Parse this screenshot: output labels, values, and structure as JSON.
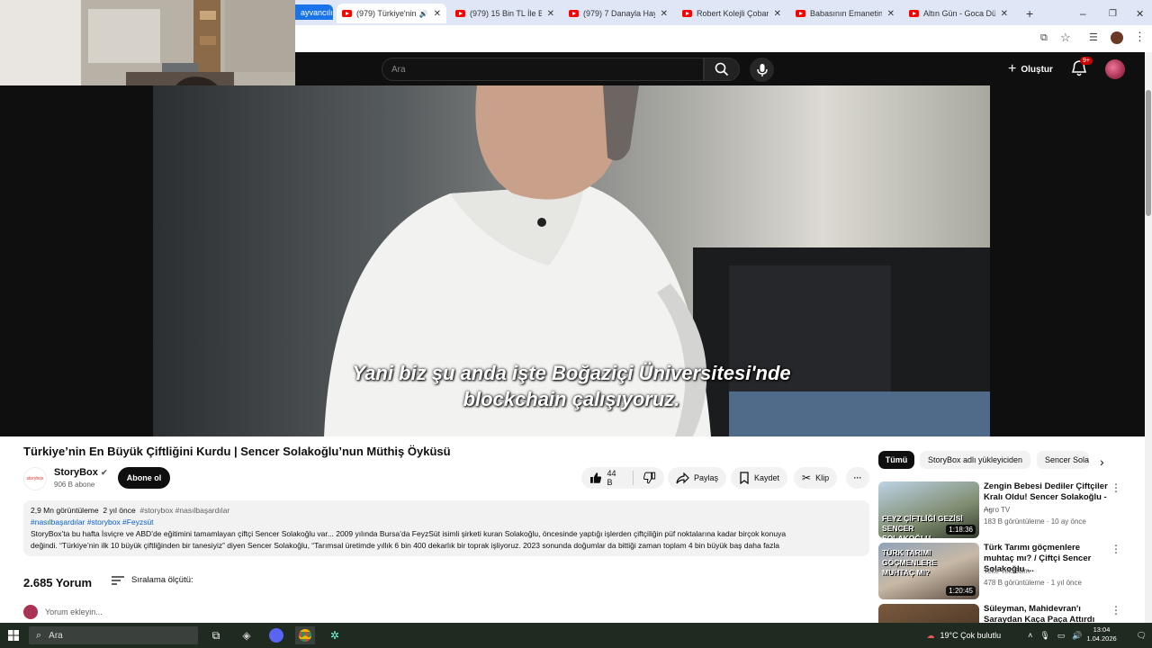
{
  "browser": {
    "tabs": [
      {
        "label": "(979) Türkiye'nin En Bü",
        "active": true
      },
      {
        "label": "(979) 15 Bin TL İle Başl"
      },
      {
        "label": "(979) 7 Danayla Hayval"
      },
      {
        "label": "Robert Kolejli Çoban |"
      },
      {
        "label": "Babasının Emanetine S"
      },
      {
        "label": "Altın Gün - Goca Dünya"
      }
    ],
    "partial_tab": "ayvancılık",
    "new_tab_label": "+"
  },
  "youtube_header": {
    "search_placeholder": "Ara",
    "create_label": "Oluştur",
    "notifications_badge": "9+"
  },
  "video": {
    "subtitle_line1": "Yani biz şu anda işte Boğaziçi Üniversitesi'nde",
    "subtitle_line2": "blockchain çalışıyoruz.",
    "title": "Türkiye’nin En Büyük Çiftliğini Kurdu | Sencer Solakoğlu’nun Müthiş Öyküsü"
  },
  "channel": {
    "name": "StoryBox",
    "subscribers": "906 B abone",
    "subscribe_label": "Abone ol",
    "logo_text": "storybox"
  },
  "actions": {
    "likes": "44 B",
    "share": "Paylaş",
    "save": "Kaydet",
    "clip": "Klip",
    "more": "···"
  },
  "description": {
    "views": "2,9 Mn görüntüleme",
    "age": "2 yıl önce",
    "tags_line1": "#storybox #nasılbaşardılar",
    "tags_line2": "#nasılbaşardılar #storybox #Feyzsüt",
    "line1": "StoryBox’ta bu hafta İsviçre ve ABD’de eğitimini tamamlayan çiftçi Sencer Solakoğlu var... 2009 yılında Bursa’da FeyzSüt isimli şirketi kuran Solakoğlu, öncesinde yaptığı işlerden çiftçiliğin püf noktalarına kadar birçok konuya",
    "line2": "değindi. “Türkiye’nin ilk 10 büyük çiftliğinden bir tanesiyiz” diyen Sencer Solakoğlu, “Tarımsal üretimde yıllık 6 bin 400 dekarlık bir toprak işliyoruz. 2023 sonunda doğumlar da bittiği zaman toplam 4 bin büyük baş daha fazla"
  },
  "comments": {
    "count": "2.685 Yorum",
    "sort_label": "Sıralama ölçütü:",
    "add_placeholder": "Yorum ekleyin..."
  },
  "sidebar": {
    "chips": [
      "Tümü",
      "StoryBox adlı yükleyiciden",
      "Sencer Solak"
    ],
    "recommendations": [
      {
        "title": "Zengin Bebesi Dediler Çiftçiler Kralı Oldu! Sencer Solakoğlu - ...",
        "channel": "Agro TV",
        "meta": "183 B görüntüleme · 10 ay önce",
        "duration": "1:18:36",
        "thumb_text": "FEYZ ÇİFTLİĞİ GEZİSİ SENCER SOLAKOĞLU"
      },
      {
        "title": "Türk Tarımı göçmenlere muhtaç mı? / Çiftçi Sencer Solakoğlu ...",
        "channel": "Teke Tek Bilim",
        "meta": "478 B görüntüleme · 1 yıl önce",
        "duration": "1:20:45",
        "thumb_text": "TÜRK TARIMI GÖÇMENLERE MUHTAÇ MI?"
      },
      {
        "title": "Süleyman, Mahidevran'ı Saraydan Kaça Paça Attırdı",
        "channel": "",
        "meta": "",
        "duration": "",
        "thumb_text": ""
      }
    ]
  },
  "taskbar": {
    "search_label": "Ara",
    "weather": "19°C  Çok bulutlu",
    "time": "13:04",
    "date": "1.04.2026"
  }
}
